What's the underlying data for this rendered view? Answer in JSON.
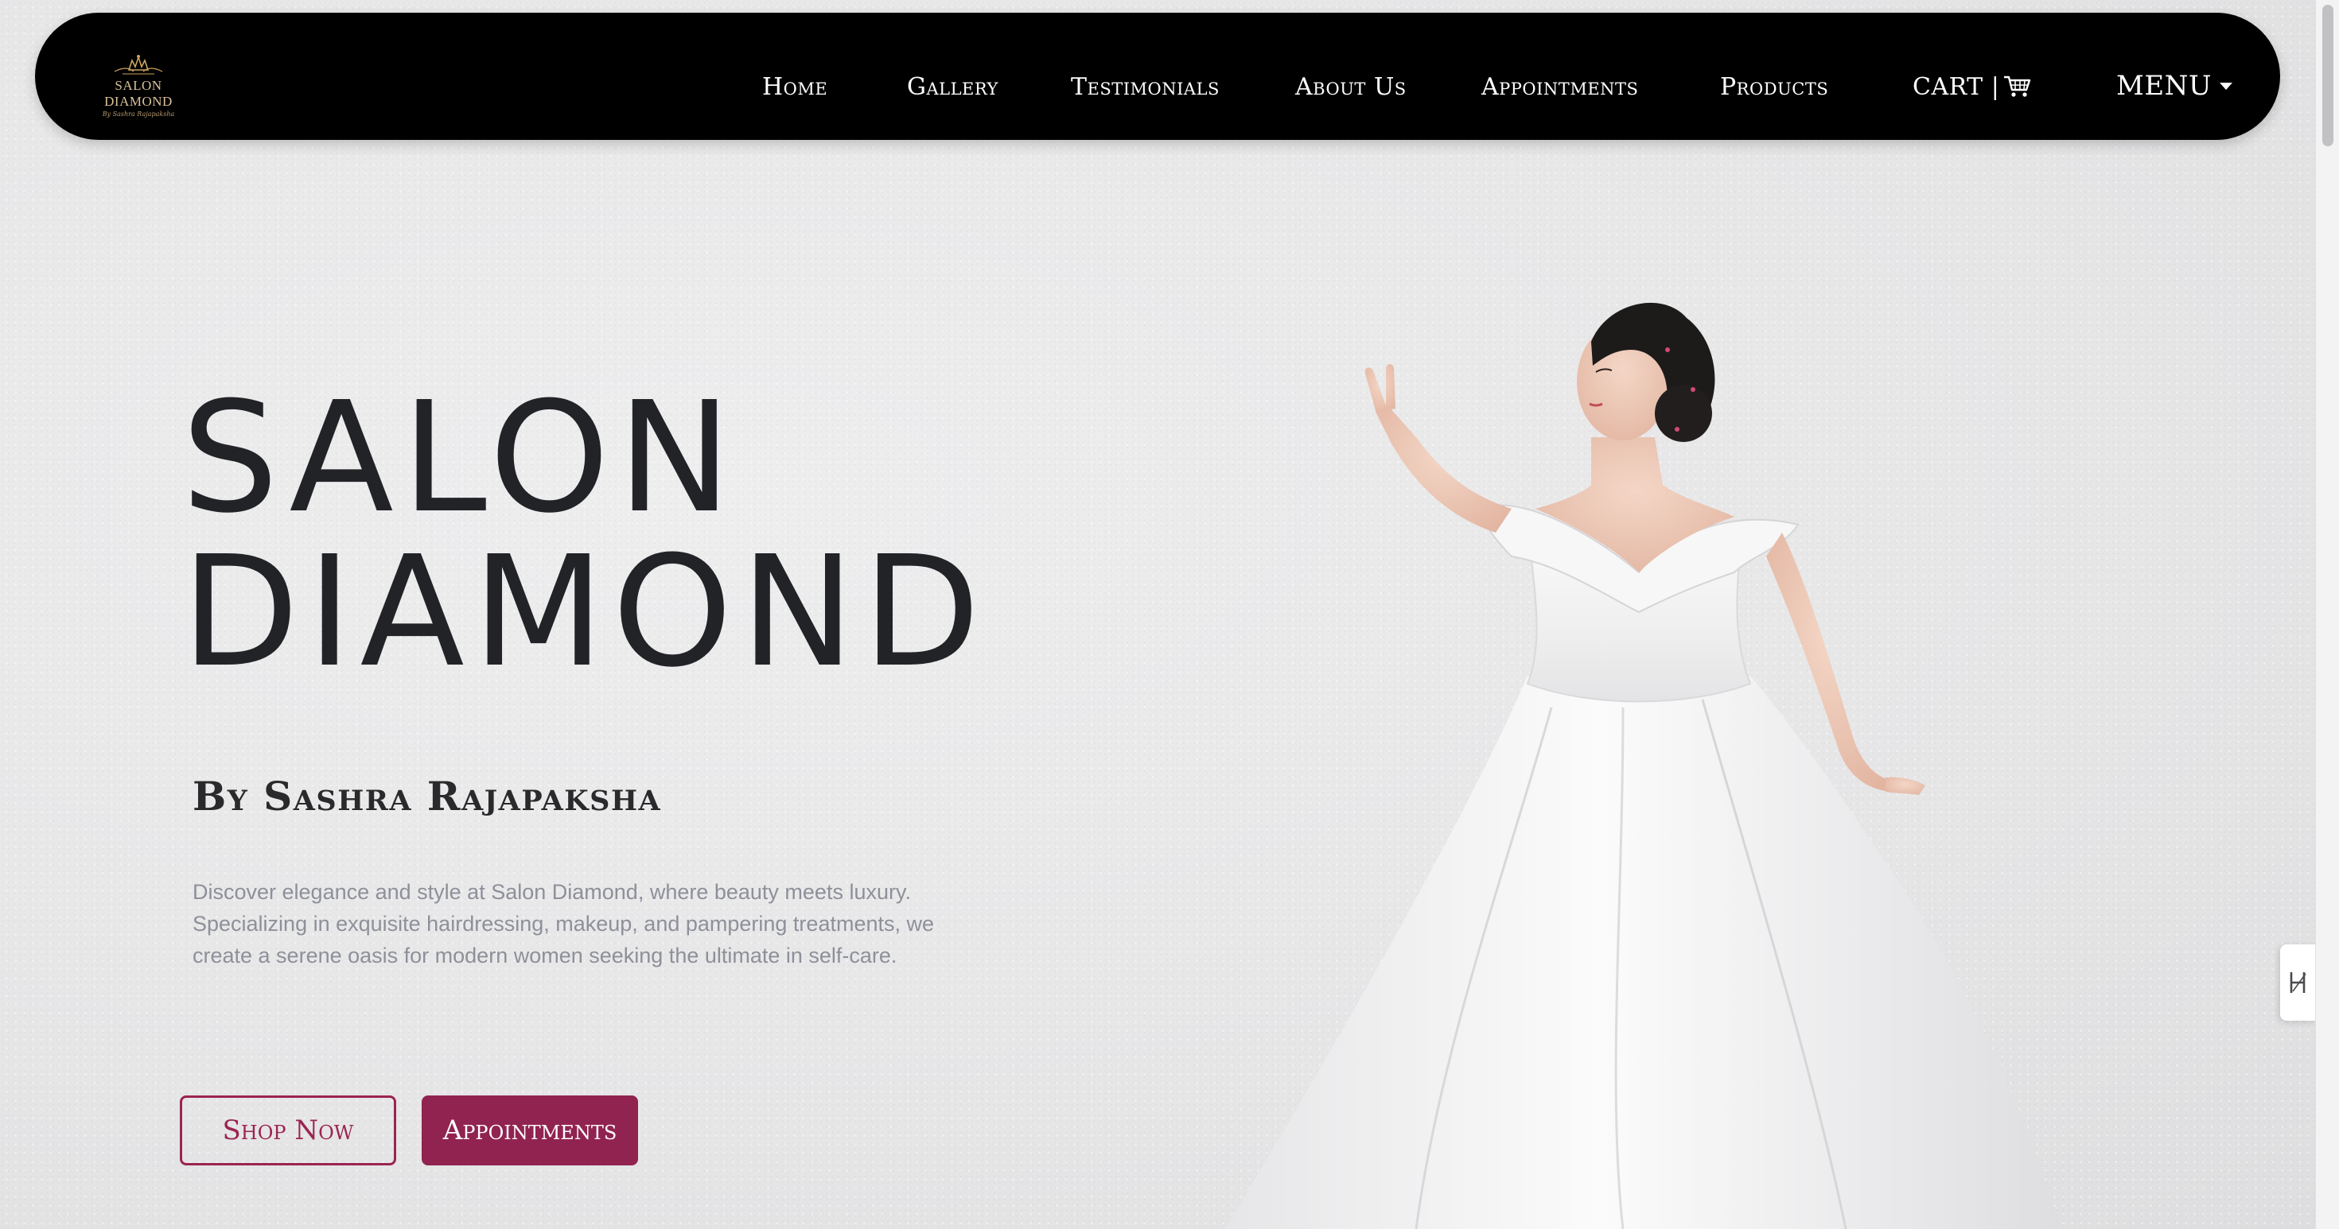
{
  "brand": {
    "logo_name": "SALON DIAMOND",
    "logo_sub": "By Sashra Rajapaksha",
    "accent": "#912350",
    "gold": "#c9a45c"
  },
  "nav": {
    "items": [
      {
        "label": "Home"
      },
      {
        "label": "Gallery"
      },
      {
        "label": "Testimonials"
      },
      {
        "label": "About Us"
      },
      {
        "label": "Appointments"
      },
      {
        "label": "Products"
      },
      {
        "label": "CART |"
      }
    ],
    "menu_label": "MENU",
    "cart_icon": "shopping-cart-icon",
    "menu_icon": "caret-down-icon"
  },
  "hero": {
    "title_line1": "SALON",
    "title_line2": "DIAMOND",
    "subtitle": "By Sashra Rajapaksha",
    "description": "Discover elegance and style at Salon Diamond, where beauty meets luxury. Specializing in exquisite hairdressing, makeup, and pampering treatments, we create a serene oasis for modern women seeking the ultimate in self-care.",
    "shop_button": "Shop Now",
    "appointments_button": "Appointments"
  },
  "widgets": {
    "side_widget_icon": "h-slash-icon"
  }
}
